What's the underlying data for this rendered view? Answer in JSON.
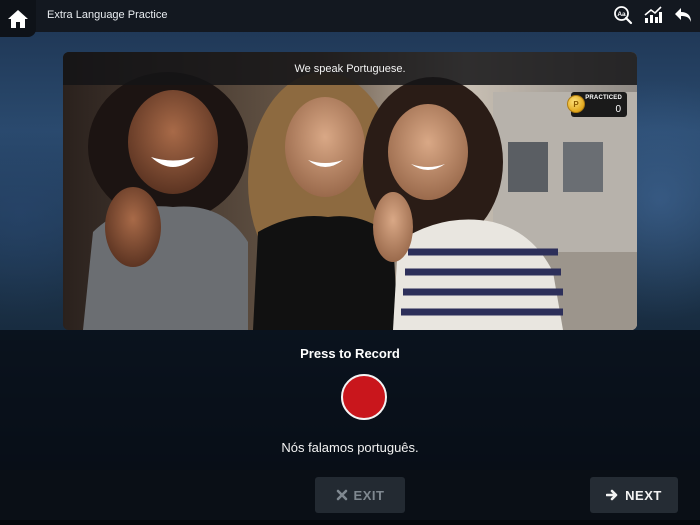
{
  "app": {
    "title": "Extra Language Practice"
  },
  "icons": {
    "home": "home-icon",
    "text_size": "text-size-icon",
    "progress": "progress-chart-icon",
    "back": "back-arrow-icon"
  },
  "card": {
    "caption": "We speak Portuguese.",
    "image_description": "photo of three smiling women",
    "practiced": {
      "label": "PRACTICED",
      "count": "0",
      "coin_letter": "P"
    }
  },
  "recorder": {
    "prompt": "Press to Record",
    "phrase": "Nós falamos português.",
    "record_color": "#c9161c"
  },
  "buttons": {
    "exit_label": "EXIT",
    "next_label": "NEXT"
  }
}
